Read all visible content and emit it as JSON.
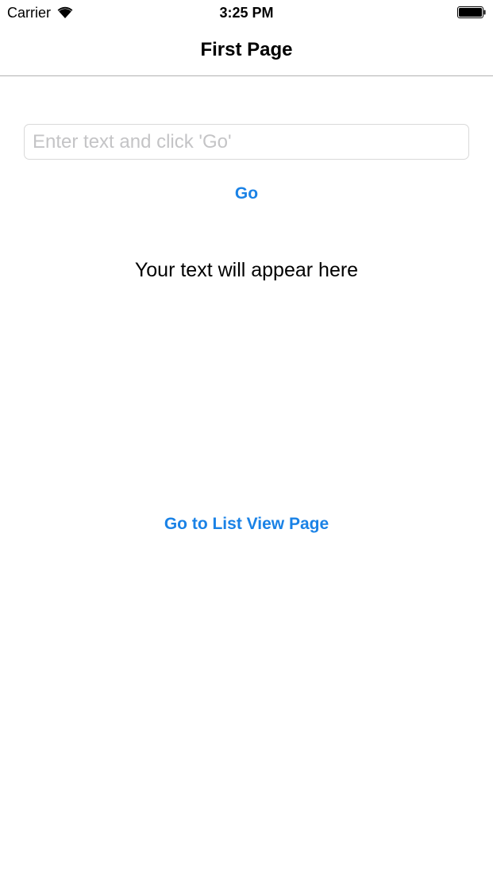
{
  "status_bar": {
    "carrier": "Carrier",
    "time": "3:25 PM",
    "icons": [
      "wifi-icon",
      "battery-icon"
    ]
  },
  "nav_bar": {
    "title": "First Page"
  },
  "form": {
    "input_value": "",
    "input_placeholder": "Enter text and click 'Go'",
    "go_label": "Go"
  },
  "output": {
    "text": "Your text will appear here"
  },
  "links": {
    "list_view_label": "Go to List View Page"
  },
  "colors": {
    "accent": "#1a82e6",
    "separator": "#b2b2b2",
    "input_border": "#d9d9d9",
    "placeholder": "#c4c4c6"
  }
}
